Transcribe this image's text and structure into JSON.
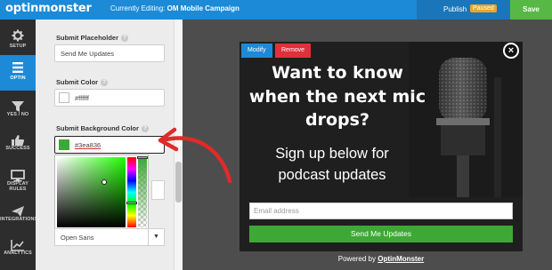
{
  "header": {
    "logo_text": "optinmonster",
    "editing_prefix": "Currently Editing:",
    "campaign_name": "OM Mobile Campaign",
    "publish_label": "Publish",
    "status_badge": "Paused",
    "save_label": "Save"
  },
  "sidebar": {
    "items": [
      {
        "label": "SETUP",
        "icon": "gear-icon"
      },
      {
        "label": "OPTIN",
        "icon": "menu-icon",
        "active": true
      },
      {
        "label": "YES / NO",
        "icon": "filter-icon"
      },
      {
        "label": "SUCCESS",
        "icon": "thumbs-up-icon"
      },
      {
        "label": "DISPLAY RULES",
        "icon": "monitor-icon"
      },
      {
        "label": "INTEGRATIONS",
        "icon": "paper-plane-icon"
      },
      {
        "label": "ANALYTICS",
        "icon": "chart-icon"
      }
    ]
  },
  "settings": {
    "submit_placeholder_label": "Submit Placeholder",
    "submit_placeholder_value": "Send Me Updates",
    "submit_color_label": "Submit Color",
    "submit_color_value": "#ffffff",
    "submit_bg_label": "Submit Background Color",
    "submit_bg_value": "#3ea836",
    "font_select_value": "Open Sans",
    "help_glyph": "?"
  },
  "popup": {
    "modify_label": "Modify",
    "remove_label": "Remove",
    "close_glyph": "×",
    "headline": "Want to know when the next mic drops?",
    "subheadline": "Sign up below for podcast updates",
    "email_placeholder": "Email address",
    "button_label": "Send Me Updates"
  },
  "footer": {
    "powered_prefix": "Powered by",
    "powered_brand": "OptinMonster"
  },
  "colors": {
    "primary_blue": "#1c8ad6",
    "save_green": "#58b846",
    "paused_orange": "#e8a72c",
    "remove_red": "#e0303b",
    "submit_green": "#3ea836",
    "annotation_arrow_red": "#e12a2a"
  }
}
